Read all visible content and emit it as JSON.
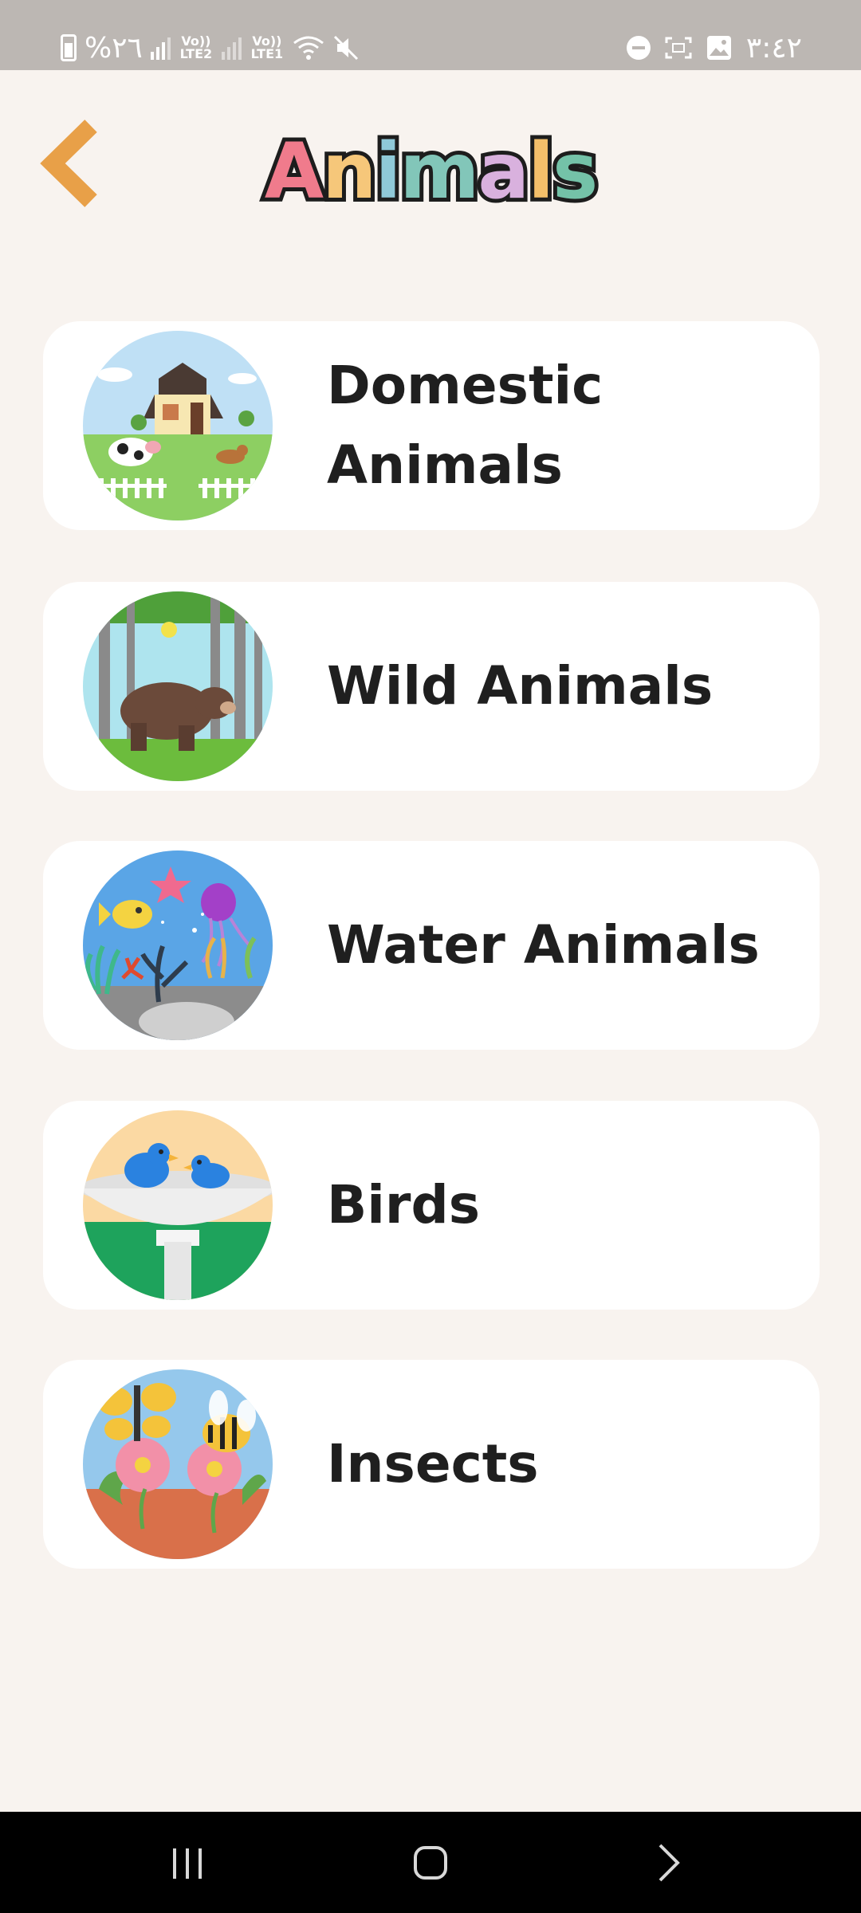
{
  "status_bar": {
    "battery_text": "%٢٦",
    "network_1": "Vo)) LTE2",
    "network_2": "Vo)) LTE1",
    "time": "٣:٤٢"
  },
  "header": {
    "back_icon": "chevron-left-icon",
    "title": "Animals",
    "title_colors": [
      "#f07b8c",
      "#f6c77a",
      "#8fc9d8",
      "#82c6b9",
      "#d9b1de",
      "#f4bf6a",
      "#74c2a8",
      "#a57be8"
    ]
  },
  "categories": [
    {
      "label": "Domestic\nAnimals",
      "icon": "farm-house-icon"
    },
    {
      "label": "Wild Animals",
      "icon": "bear-forest-icon"
    },
    {
      "label": "Water Animals",
      "icon": "sea-life-icon"
    },
    {
      "label": "Birds",
      "icon": "birdbath-icon"
    },
    {
      "label": "Insects",
      "icon": "butterfly-bee-icon"
    }
  ],
  "nav": {
    "recent_icon": "recent-apps-icon",
    "home_icon": "home-icon",
    "back_icon": "back-icon"
  },
  "colors": {
    "background": "#f8f3ef",
    "card": "#ffffff",
    "accent": "#e8a048",
    "text": "#1f1f1f"
  }
}
